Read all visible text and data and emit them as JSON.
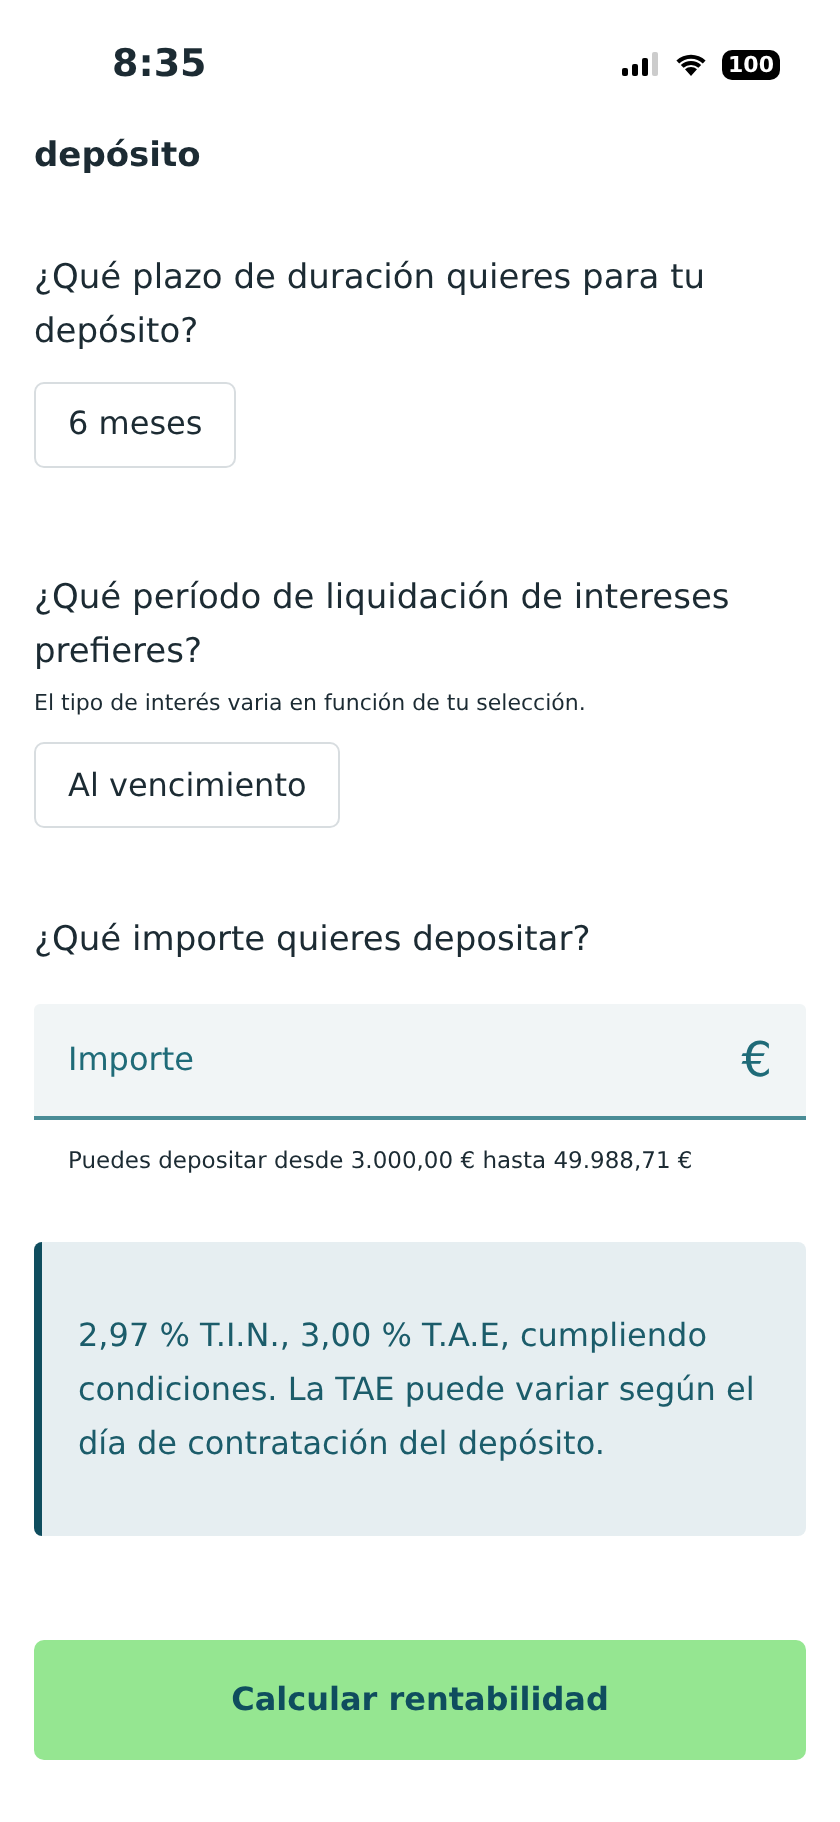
{
  "status_bar": {
    "time": "8:35",
    "battery": "100"
  },
  "header": {
    "title": "depósito"
  },
  "sections": [
    {
      "question": "¿Qué plazo de duración quieres para tu depósito?",
      "option": "6 meses"
    },
    {
      "question": "¿Qué período de liquidación de intereses prefieres?",
      "hint": "El tipo de interés varia en función de tu selección.",
      "option": "Al vencimiento"
    }
  ],
  "amount": {
    "question": "¿Qué importe quieres depositar?",
    "placeholder": "Importe",
    "currency": "€",
    "helper": "Puedes depositar desde 3.000,00 € hasta 49.988,71 €"
  },
  "info": "2,97 % T.I.N., 3,00 % T.A.E, cumpliendo condiciones. La TAE puede variar según el día de contratación del depósito.",
  "button": "Calcular rentabilidad"
}
